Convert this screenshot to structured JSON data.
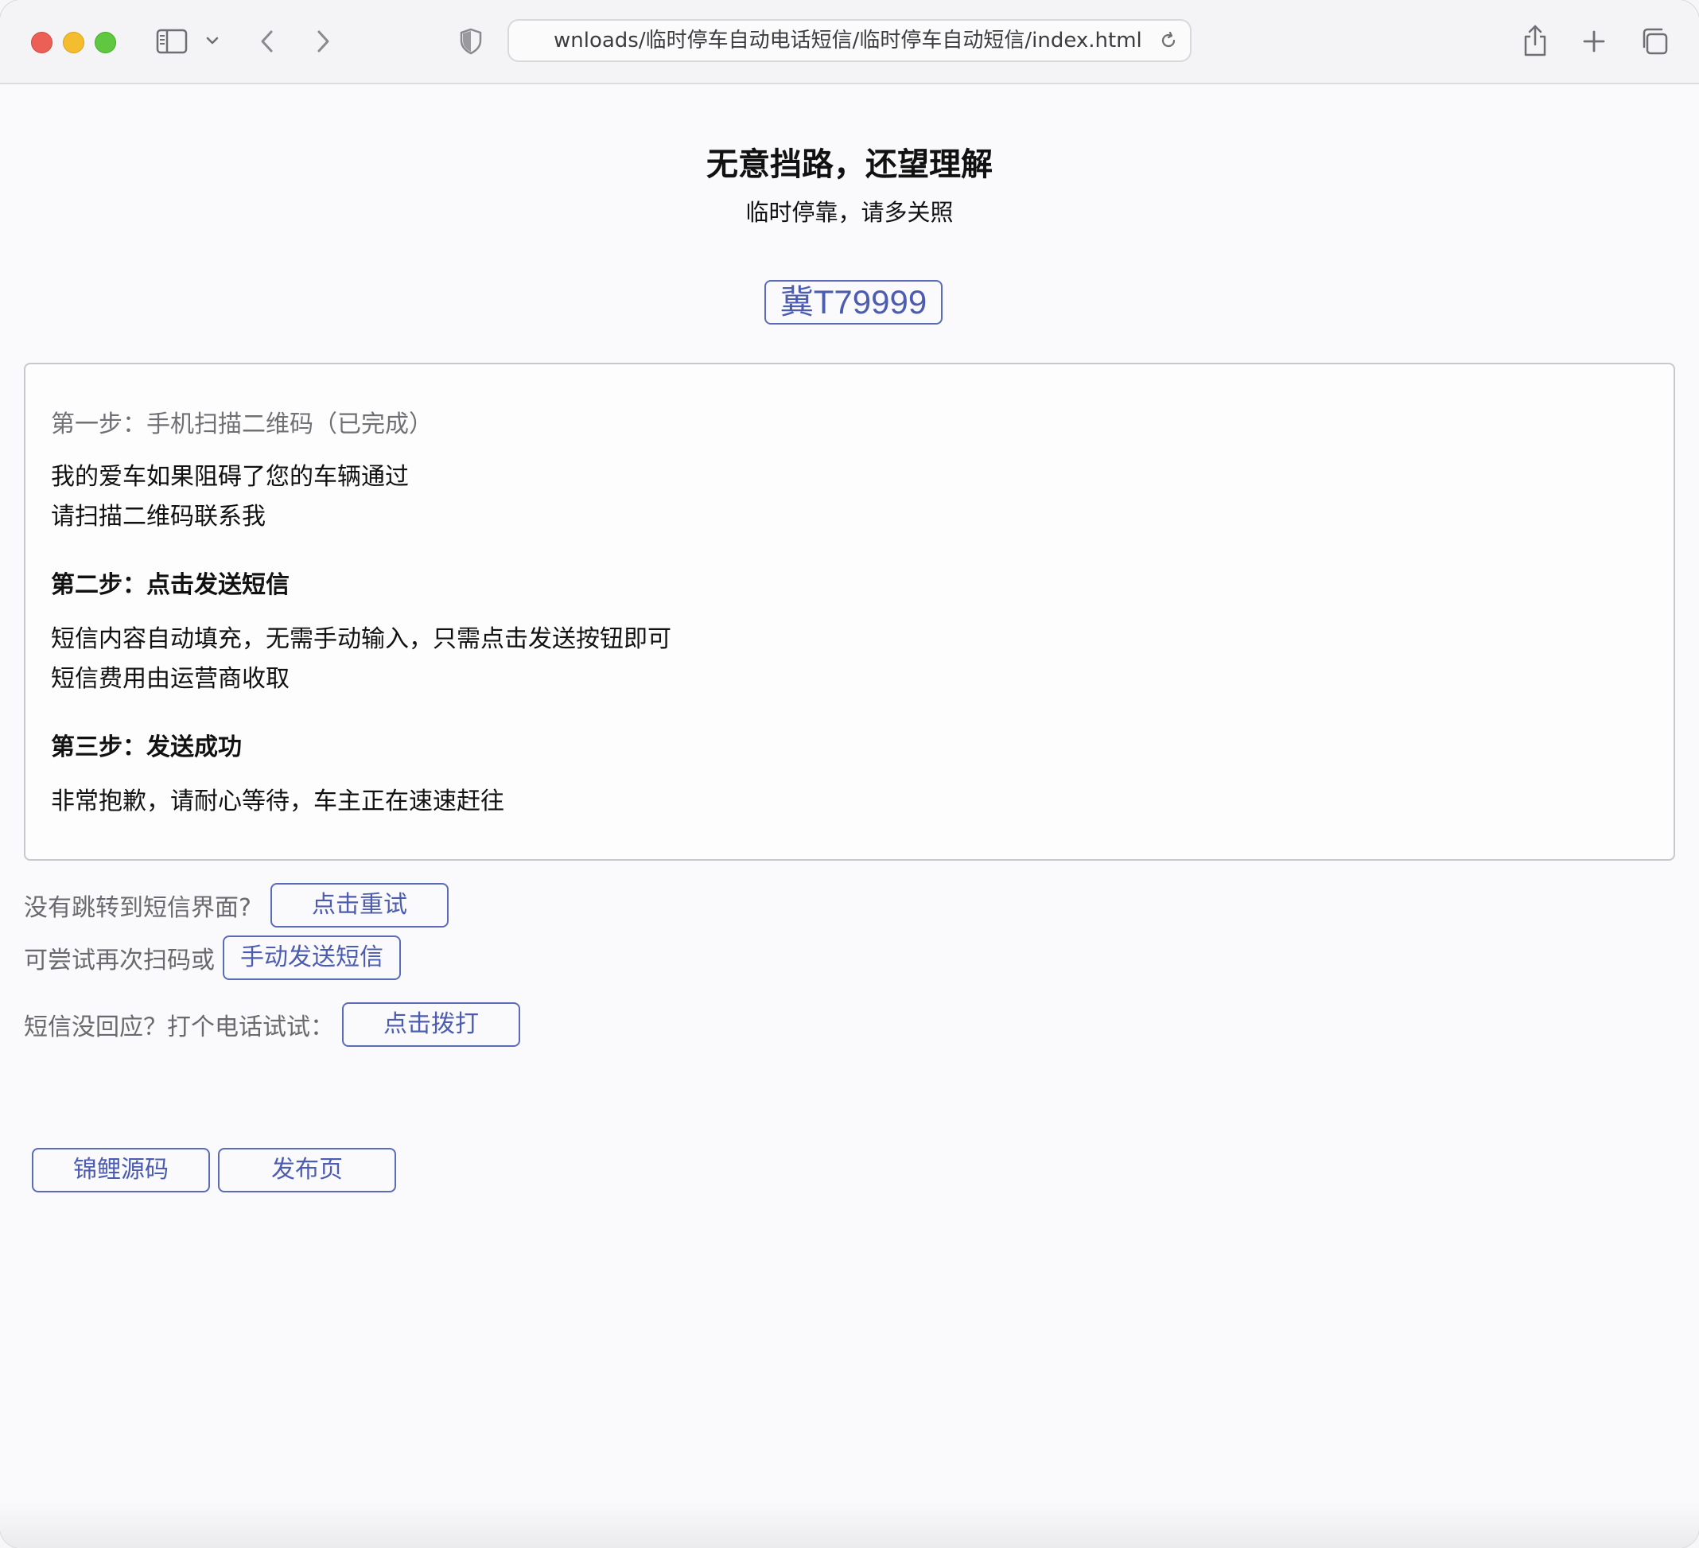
{
  "browser": {
    "url": "wnloads/临时停车自动电话短信/临时停车自动短信/index.html"
  },
  "page": {
    "headline": "无意挡路，还望理解",
    "subhead": "临时停靠，请多关照",
    "plate": "冀T79999",
    "steps": {
      "step1_title": "第一步：手机扫描二维码（已完成）",
      "step1_line1": "我的爱车如果阻碍了您的车辆通过",
      "step1_line2": "请扫描二维码联系我",
      "step2_title": "第二步：点击发送短信",
      "step2_line1": "短信内容自动填充，无需手动输入，只需点击发送按钮即可",
      "step2_line2": "短信费用由运营商收取",
      "step3_title": "第三步：发送成功",
      "step3_line1": "非常抱歉，请耐心等待，车主正在速速赶往"
    },
    "actions": {
      "retry_label": "没有跳转到短信界面?",
      "retry_button": "点击重试",
      "manual_label": "可尝试再次扫码或",
      "manual_button": "手动发送短信",
      "call_label": "短信没回应？打个电话试试：",
      "call_button": "点击拨打"
    },
    "footer": {
      "source_button": "锦鲤源码",
      "publish_button": "发布页"
    }
  },
  "colors": {
    "accent": "#4c5cb0",
    "border": "#5a6bb8"
  }
}
